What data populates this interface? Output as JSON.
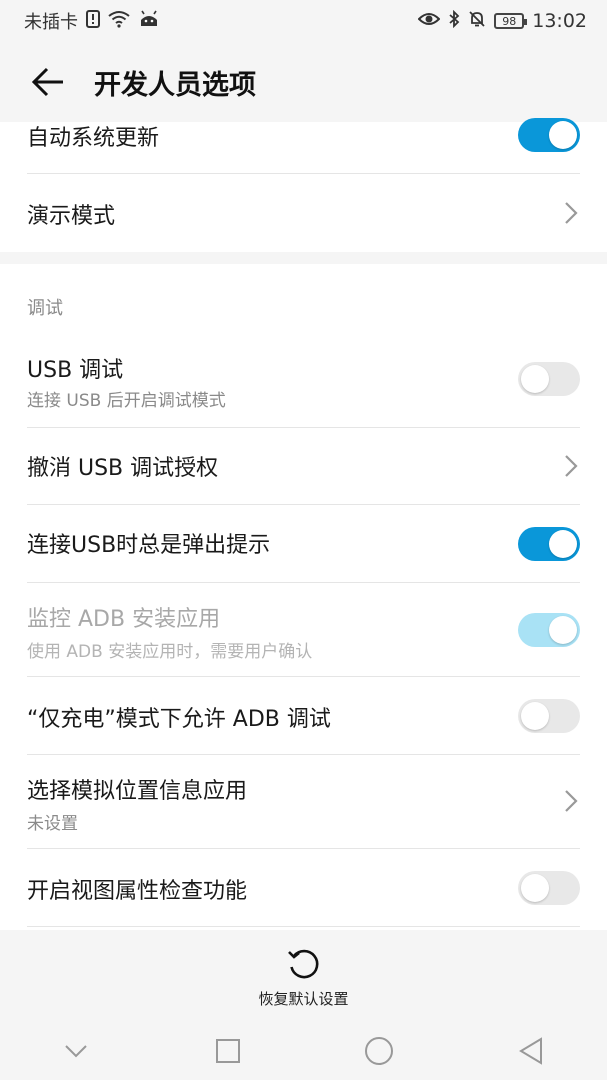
{
  "status_bar": {
    "carrier": "未插卡",
    "battery": "98",
    "time": "13:02"
  },
  "header": {
    "title": "开发人员选项"
  },
  "top_group": {
    "items": [
      {
        "title": "自动系统更新",
        "control": "toggle",
        "state": "on"
      },
      {
        "title": "演示模式",
        "control": "chevron"
      }
    ]
  },
  "debug_section": {
    "header": "调试",
    "items": [
      {
        "title": "USB 调试",
        "subtitle": "连接 USB 后开启调试模式",
        "control": "toggle",
        "state": "off"
      },
      {
        "title": "撤消 USB 调试授权",
        "control": "chevron"
      },
      {
        "title": "连接USB时总是弹出提示",
        "control": "toggle",
        "state": "on"
      },
      {
        "title": "监控 ADB 安装应用",
        "subtitle": "使用 ADB 安装应用时，需要用户确认",
        "control": "toggle",
        "state": "on",
        "disabled": true
      },
      {
        "title": "“仅充电”模式下允许 ADB 调试",
        "control": "toggle",
        "state": "off"
      },
      {
        "title": "选择模拟位置信息应用",
        "subtitle": "未设置",
        "control": "chevron"
      },
      {
        "title": "开启视图属性检查功能",
        "control": "toggle",
        "state": "off"
      }
    ]
  },
  "bottom_action": {
    "label": "恢复默认设置",
    "icon": "refresh-icon"
  },
  "nav_bar": {
    "icons": [
      "chevron-down-icon",
      "square-icon",
      "circle-icon",
      "triangle-back-icon"
    ]
  },
  "colors": {
    "accent": "#0a97d9",
    "accent_disabled": "#a9e2f5",
    "toggle_off": "#e8e8e8"
  }
}
